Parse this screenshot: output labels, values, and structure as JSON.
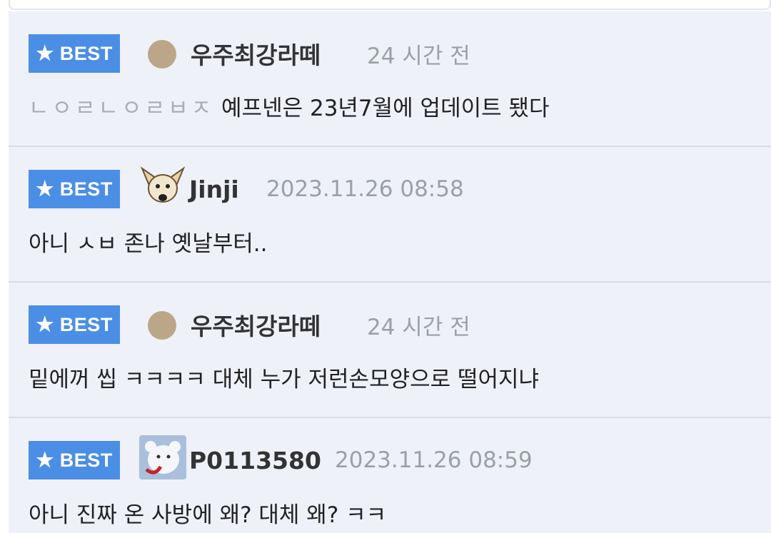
{
  "comments": [
    {
      "badge": "BEST",
      "avatar": "tan-dot",
      "username": "우주최강라떼",
      "timestamp": "24 시간 전",
      "body_faded": "ㄴㅇㄹㄴㅇㄹㅂㅈ",
      "body": "예프넨은 23년7월에 업데이트 됐다"
    },
    {
      "badge": "BEST",
      "avatar": "chihuahua",
      "username": "Jinji",
      "timestamp": "2023.11.26 08:58",
      "body": "아니 ㅅㅂ 존나 옛날부터.."
    },
    {
      "badge": "BEST",
      "avatar": "tan-dot",
      "username": "우주최강라떼",
      "timestamp": "24 시간 전",
      "body": "밑에꺼 씹 ㅋㅋㅋㅋ 대체 누가 저런손모양으로 떨어지냐"
    },
    {
      "badge": "BEST",
      "avatar": "white-bear",
      "username": "P0113580",
      "timestamp": "2023.11.26 08:59",
      "body": "아니 진짜 온 사방에 왜? 대체 왜? ㅋㅋ"
    }
  ],
  "colors": {
    "badge_bg": "#4a8ee6",
    "list_bg": "#eef1f8",
    "timestamp": "#9aa0a8"
  }
}
